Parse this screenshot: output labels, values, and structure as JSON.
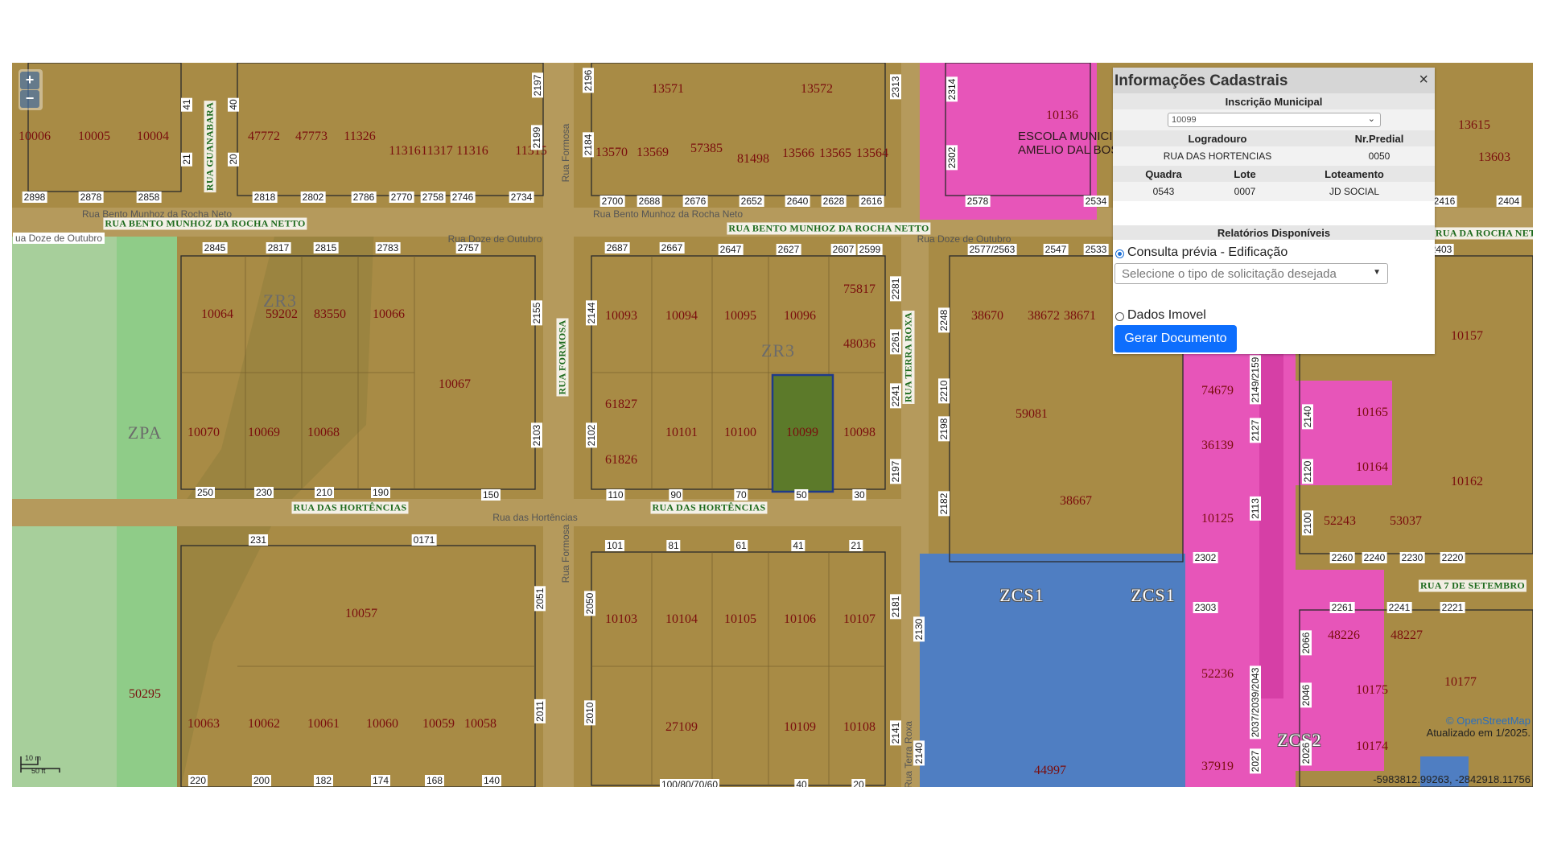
{
  "map": {
    "zoom_in": "+",
    "zoom_out": "−",
    "scale_m": "10 m",
    "scale_ft": "50 ft",
    "attribution": "© OpenStreetMap",
    "updated": "Atualizado em 1/2025.",
    "coordinates": "-5983812.99263, -2842918.11756",
    "school": [
      "ESCOLA MUNICIP",
      "AMELIO DAL BOSCO"
    ],
    "parcels": [
      "10006",
      "10005",
      "10004",
      "47772",
      "47773",
      "11326",
      "11316",
      "11317",
      "11316",
      "11315",
      "13571",
      "13572",
      "13570",
      "13569",
      "57385",
      "81498",
      "13566",
      "13565",
      "13564",
      "10136",
      "10064",
      "59202",
      "83550",
      "10066",
      "10067",
      "10070",
      "10069",
      "10068",
      "10093",
      "10094",
      "10095",
      "10096",
      "75817",
      "48036",
      "61827",
      "10101",
      "10100",
      "10099",
      "10098",
      "61826",
      "38670",
      "38672",
      "38671",
      "59081",
      "38667",
      "10057",
      "10103",
      "10104",
      "10105",
      "10106",
      "10107",
      "10063",
      "10062",
      "10061",
      "10060",
      "10059",
      "10058",
      "27109",
      "10109",
      "10108",
      "50295",
      "44997",
      "74679",
      "36139",
      "10125",
      "52236",
      "37919",
      "10165",
      "10164",
      "10162",
      "10157",
      "52243",
      "53037",
      "48226",
      "48227",
      "10175",
      "10174",
      "10177",
      "13615",
      "13603"
    ],
    "numbers": [
      "2898",
      "2878",
      "2858",
      "2818",
      "2802",
      "2786",
      "2770",
      "2758",
      "2746",
      "2734",
      "2700",
      "2688",
      "2676",
      "2652",
      "2640",
      "2628",
      "2616",
      "2578",
      "2534",
      "2416",
      "2404",
      "2845",
      "2817",
      "2815",
      "2783",
      "2757",
      "2687",
      "2667",
      "2647",
      "2627",
      "2607",
      "2599",
      "2577/2563",
      "2547",
      "2533",
      "2403",
      "250",
      "230",
      "210",
      "190",
      "150",
      "110",
      "90",
      "70",
      "50",
      "30",
      "231",
      "0171",
      "101",
      "81",
      "61",
      "41",
      "21",
      "2302",
      "2303",
      "2261",
      "2241",
      "2221",
      "2260",
      "2240",
      "2230",
      "2220",
      "220",
      "200",
      "182",
      "174",
      "168",
      "140",
      "100/80/70/60",
      "40",
      "20",
      "2197",
      "2196",
      "2184",
      "2313",
      "2314",
      "2302",
      "41",
      "40",
      "21",
      "20",
      "2199",
      "2155",
      "2103",
      "2144",
      "2102",
      "2281",
      "2261",
      "2241",
      "2197",
      "2248",
      "2210",
      "2198",
      "2182",
      "2149/2159",
      "2127",
      "2113",
      "2140",
      "2120",
      "2100",
      "2051",
      "2011",
      "2050",
      "2010",
      "2181",
      "2141",
      "2130",
      "2140",
      "2066",
      "2046",
      "2026",
      "2037/2039/2043",
      "2027"
    ],
    "zones": [
      "ZR3",
      "ZR3",
      "ZPA",
      "ZCS1",
      "ZCS1",
      "ZCS2"
    ],
    "streets": [
      "RUA BENTO MUNHOZ DA ROCHA NETTO",
      "RUA BENTO MUNHOZ DA ROCHA NETTO",
      "RUA DAS HORTÊNCIAS",
      "RUA DAS HORTÊNCIAS",
      "RUA FORMOSA",
      "RUA TERRA ROXA",
      "RUA GUANABARA",
      "RUA 7 DE SETEMBRO",
      "RUA DA ROCHA NETTO"
    ],
    "osm_streets": [
      "Rua Bento Munhoz da Rocha Neto",
      "Rua Bento Munhoz da Rocha Neto",
      "Rua Doze de Outubro",
      "Rua Doze de Outubro",
      "ua Doze de Outubro",
      "Rua das Hortências",
      "Rua Formosa",
      "Rua Formosa",
      "Rua Terra Roxa"
    ],
    "colors": {
      "base": "#a88b45",
      "commercial": "#e755b9",
      "zcs1": "#4f7ec2",
      "zpa": "#8fd08a",
      "selected": "#5c7a2a"
    }
  },
  "panel": {
    "title": "Informações Cadastrais",
    "close": "×",
    "inscricao_label": "Inscrição Municipal",
    "inscricao_value": "10099",
    "logradouro_label": "Logradouro",
    "predial_label": "Nr.Predial",
    "logradouro_value": "RUA DAS HORTENCIAS",
    "predial_value": "0050",
    "quadra_label": "Quadra",
    "lote_label": "Lote",
    "loteamento_label": "Loteamento",
    "quadra_value": "0543",
    "lote_value": "0007",
    "loteamento_value": "JD SOCIAL",
    "relatorios_label": "Relatórios Disponíveis",
    "option1": "Consulta prévia - Edificação",
    "select_placeholder": "Selecione o tipo de solicitação desejada",
    "option2": "Dados Imovel",
    "button": "Gerar Documento"
  }
}
